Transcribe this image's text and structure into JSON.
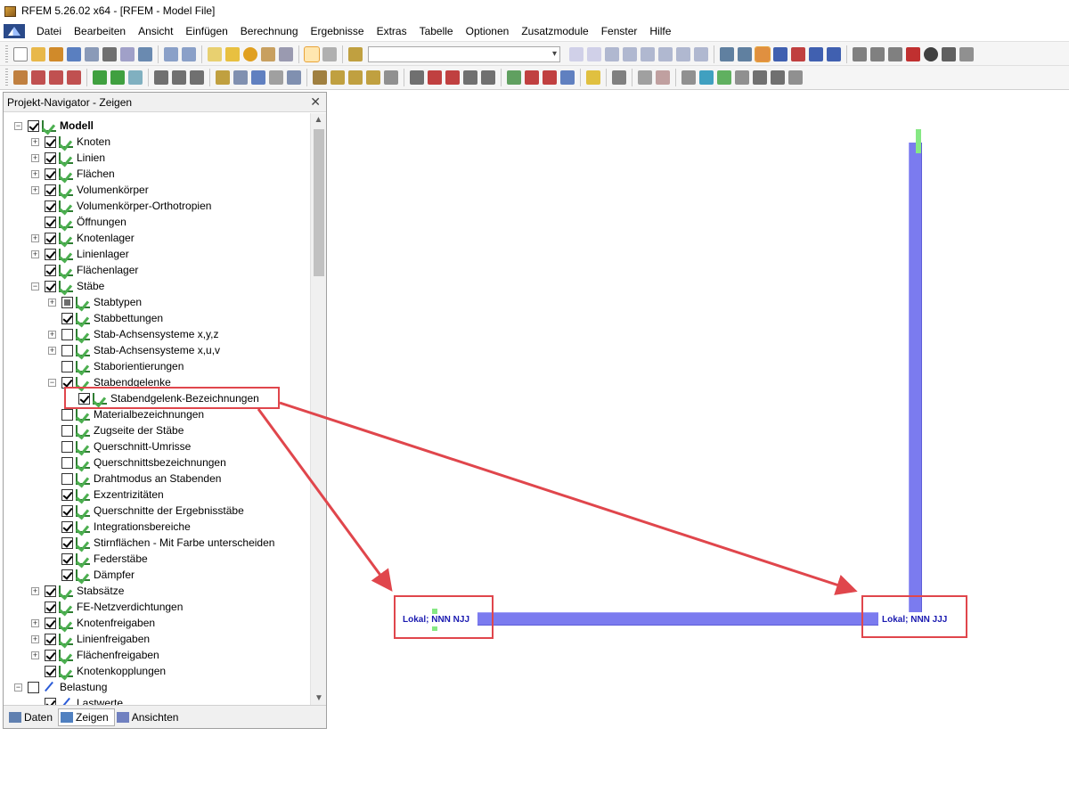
{
  "window": {
    "title": "RFEM 5.26.02 x64 - [RFEM - Model File]"
  },
  "menu": {
    "items": [
      {
        "label": "Datei"
      },
      {
        "label": "Bearbeiten"
      },
      {
        "label": "Ansicht"
      },
      {
        "label": "Einfügen"
      },
      {
        "label": "Berechnung"
      },
      {
        "label": "Ergebnisse"
      },
      {
        "label": "Extras"
      },
      {
        "label": "Tabelle"
      },
      {
        "label": "Optionen"
      },
      {
        "label": "Zusatzmodule"
      },
      {
        "label": "Fenster"
      },
      {
        "label": "Hilfe"
      }
    ]
  },
  "toolbar": {
    "combo_value": ""
  },
  "navigator": {
    "title": "Projekt-Navigator - Zeigen",
    "close_symbol": "✕",
    "tree": [
      {
        "label": "Modell",
        "checked": "checked",
        "bold": true,
        "expander": "−"
      },
      {
        "label": "Knoten",
        "checked": "checked",
        "expander": "+"
      },
      {
        "label": "Linien",
        "checked": "checked",
        "expander": "+"
      },
      {
        "label": "Flächen",
        "checked": "checked",
        "expander": "+"
      },
      {
        "label": "Volumenkörper",
        "checked": "checked",
        "expander": "+"
      },
      {
        "label": "Volumenkörper-Orthotropien",
        "checked": "checked",
        "expander": ""
      },
      {
        "label": "Öffnungen",
        "checked": "checked",
        "expander": ""
      },
      {
        "label": "Knotenlager",
        "checked": "checked",
        "expander": "+"
      },
      {
        "label": "Linienlager",
        "checked": "checked",
        "expander": "+"
      },
      {
        "label": "Flächenlager",
        "checked": "checked",
        "expander": ""
      },
      {
        "label": "Stäbe",
        "checked": "checked",
        "expander": "−"
      },
      {
        "label": "Stabtypen",
        "checked": "partial",
        "expander": "+"
      },
      {
        "label": "Stabbettungen",
        "checked": "checked",
        "expander": ""
      },
      {
        "label": "Stab-Achsensysteme x,y,z",
        "checked": "",
        "expander": "+"
      },
      {
        "label": "Stab-Achsensysteme x,u,v",
        "checked": "",
        "expander": "+"
      },
      {
        "label": "Staborientierungen",
        "checked": "",
        "expander": ""
      },
      {
        "label": "Stabendgelenke",
        "checked": "checked",
        "expander": "−"
      },
      {
        "label": "Stabendgelenk-Bezeichnungen",
        "checked": "checked",
        "expander": ""
      },
      {
        "label": "Materialbezeichnungen",
        "checked": "",
        "expander": ""
      },
      {
        "label": "Zugseite der Stäbe",
        "checked": "",
        "expander": ""
      },
      {
        "label": "Querschnitt-Umrisse",
        "checked": "",
        "expander": ""
      },
      {
        "label": "Querschnittsbezeichnungen",
        "checked": "",
        "expander": ""
      },
      {
        "label": "Drahtmodus an Stabenden",
        "checked": "",
        "expander": ""
      },
      {
        "label": "Exzentrizitäten",
        "checked": "checked",
        "expander": ""
      },
      {
        "label": "Querschnitte der Ergebnisstäbe",
        "checked": "checked",
        "expander": ""
      },
      {
        "label": "Integrationsbereiche",
        "checked": "checked",
        "expander": ""
      },
      {
        "label": "Stirnflächen - Mit Farbe unterscheiden",
        "checked": "checked",
        "expander": ""
      },
      {
        "label": "Federstäbe",
        "checked": "checked",
        "expander": ""
      },
      {
        "label": "Dämpfer",
        "checked": "checked",
        "expander": ""
      },
      {
        "label": "Stabsätze",
        "checked": "checked",
        "expander": "+"
      },
      {
        "label": "FE-Netzverdichtungen",
        "checked": "checked",
        "expander": ""
      },
      {
        "label": "Knotenfreigaben",
        "checked": "checked",
        "expander": "+"
      },
      {
        "label": "Linienfreigaben",
        "checked": "checked",
        "expander": "+"
      },
      {
        "label": "Flächenfreigaben",
        "checked": "checked",
        "expander": "+"
      },
      {
        "label": "Knotenkopplungen",
        "checked": "checked",
        "expander": ""
      },
      {
        "label": "Belastung",
        "checked": "",
        "expander": "−"
      },
      {
        "label": "Lastwerte",
        "checked": "checked",
        "expander": ""
      }
    ],
    "tabs": [
      {
        "label": "Daten"
      },
      {
        "label": "Zeigen"
      },
      {
        "label": "Ansichten"
      }
    ]
  },
  "model": {
    "hinge_label_left": "Lokal; NNN NJJ",
    "hinge_label_right": "Lokal; NNN JJJ"
  },
  "colors": {
    "member": "#7b7bef",
    "node": "#86e884",
    "annotation": "#e0464c",
    "hinge_text": "#1a1ab0"
  }
}
